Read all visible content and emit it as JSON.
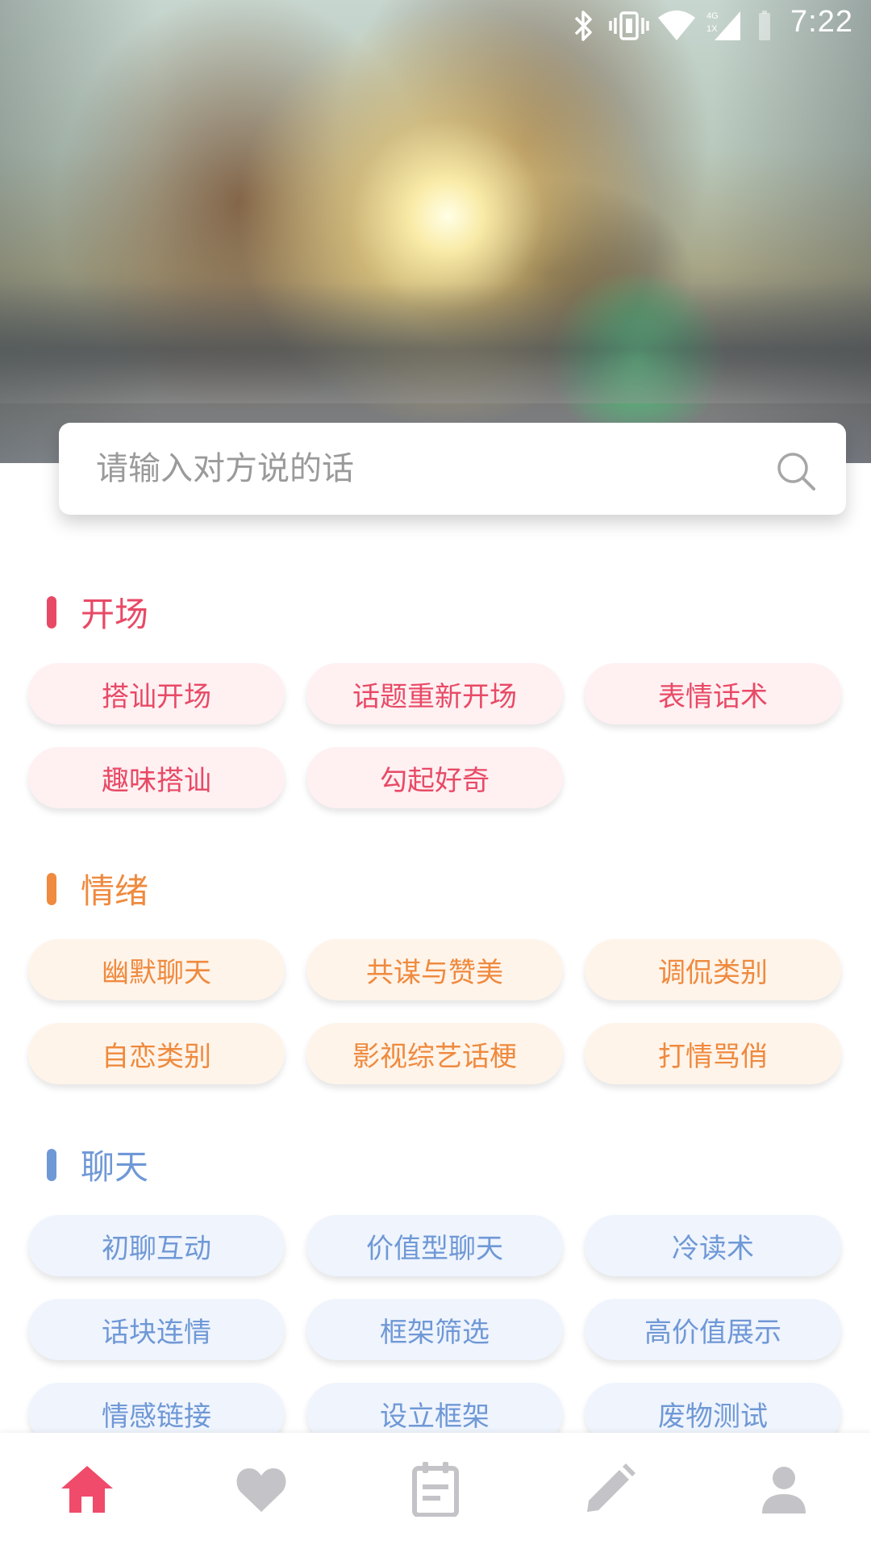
{
  "status_bar": {
    "time": "7:22",
    "network_label_top": "4G",
    "network_label_bottom": "1X",
    "icons": [
      "bluetooth-icon",
      "vibrate-icon",
      "wifi-icon",
      "cellular-signal-icon"
    ]
  },
  "hero": {
    "description_icon": "couple-sunset-photo"
  },
  "search": {
    "placeholder": "请输入对方说的话",
    "icon": "search-icon"
  },
  "sections": [
    {
      "title": "开场",
      "color": "#e84a66",
      "items": [
        "搭讪开场",
        "话题重新开场",
        "表情话术",
        "趣味搭讪",
        "勾起好奇"
      ]
    },
    {
      "title": "情绪",
      "color": "#ef8a3e",
      "items": [
        "幽默聊天",
        "共谋与赞美",
        "调侃类别",
        "自恋类别",
        "影视综艺话梗",
        "打情骂俏"
      ]
    },
    {
      "title": "聊天",
      "color": "#6f98d6",
      "items": [
        "初聊互动",
        "价值型聊天",
        "冷读术",
        "话块连情",
        "框架筛选",
        "高价值展示",
        "情感链接",
        "设立框架",
        "废物测试"
      ]
    }
  ],
  "bottom_nav": {
    "active_color": "#f04b6a",
    "inactive_color": "#c4c4c8",
    "items": [
      "home-icon",
      "heart-icon",
      "notes-icon",
      "edit-icon",
      "profile-icon"
    ],
    "active_index": 0
  }
}
